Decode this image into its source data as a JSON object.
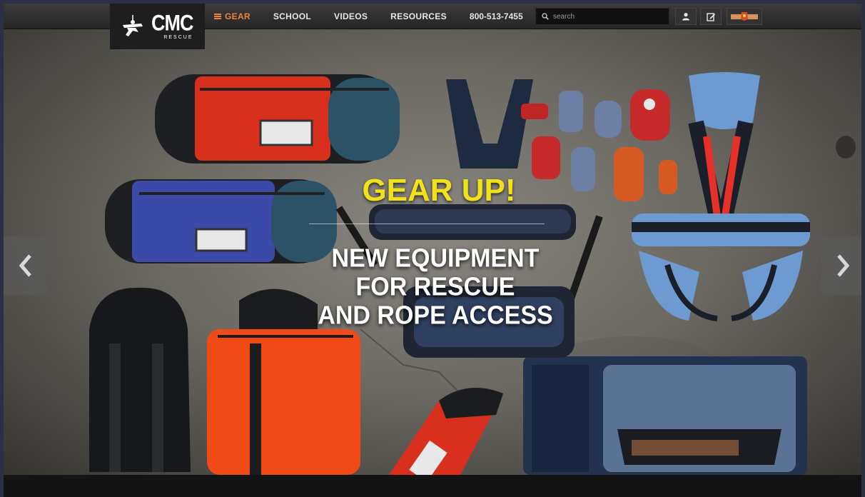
{
  "brand": {
    "name": "CMC",
    "tagline": "RESCUE"
  },
  "nav": {
    "items": [
      {
        "label": "GEAR",
        "active": true
      },
      {
        "label": "SCHOOL",
        "active": false
      },
      {
        "label": "VIDEOS",
        "active": false
      },
      {
        "label": "RESOURCES",
        "active": false
      }
    ],
    "phone": "800-513-7455"
  },
  "search": {
    "placeholder": "search"
  },
  "utility_icons": [
    "user-icon",
    "edit-icon",
    "flag-icon"
  ],
  "hero": {
    "headline": "GEAR UP!",
    "subline": [
      "NEW EQUIPMENT",
      "FOR RESCUE",
      "AND ROPE ACCESS"
    ],
    "prev_icon": "chevron-left-icon",
    "next_icon": "chevron-right-icon"
  },
  "colors": {
    "accent": "#e8843a",
    "headline": "#f2e11a",
    "background": "#2c2f45"
  }
}
